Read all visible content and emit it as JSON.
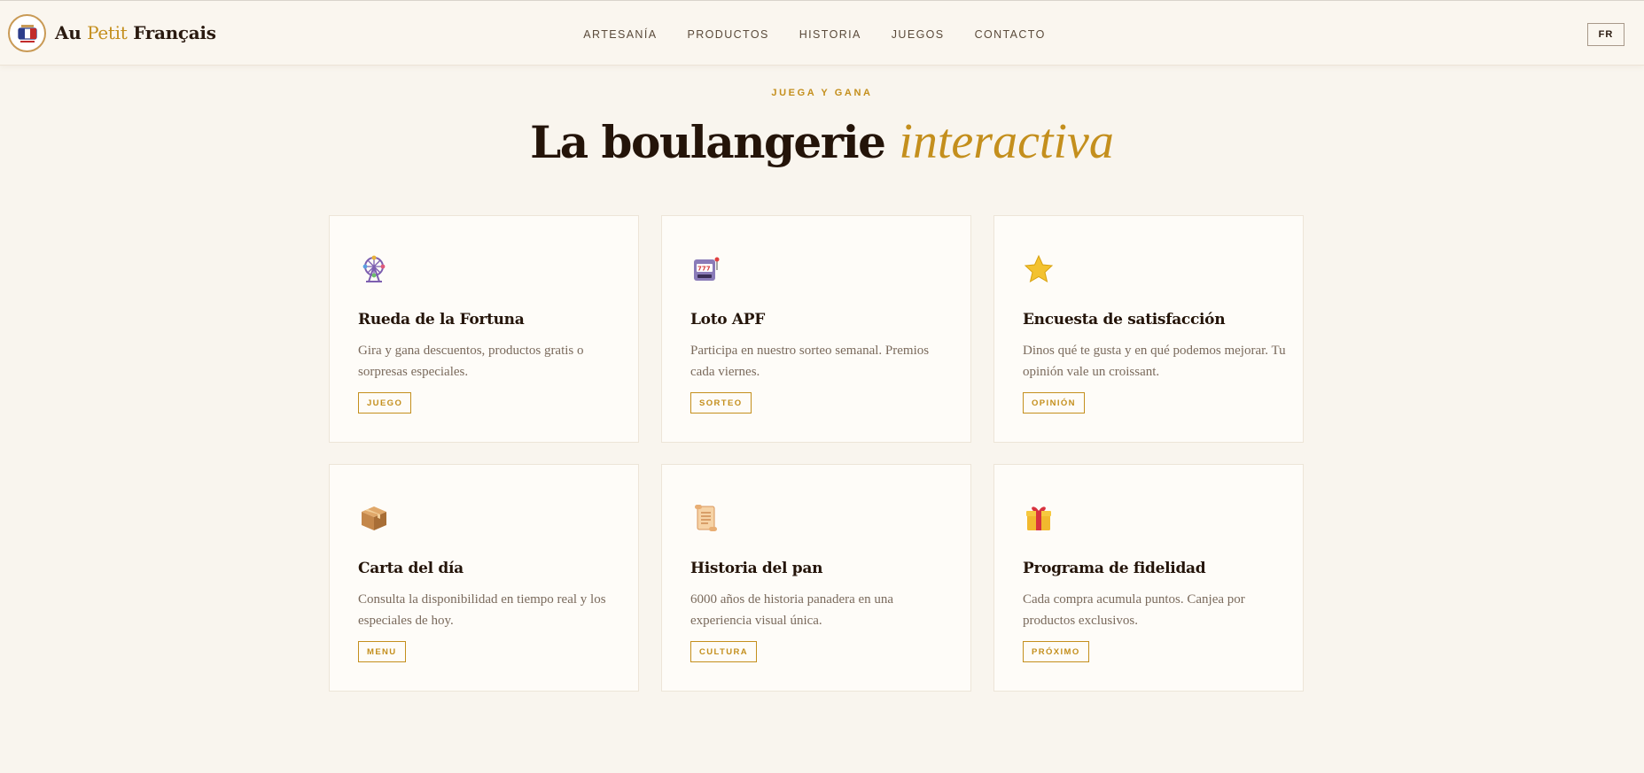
{
  "header": {
    "brand": {
      "part1": "Au",
      "part2": "Petit",
      "part3": "Français"
    },
    "nav": [
      "ARTESANÍA",
      "PRODUCTOS",
      "HISTORIA",
      "JUEGOS",
      "CONTACTO"
    ],
    "lang": "FR"
  },
  "hero": {
    "eyebrow": "JUEGA Y GANA",
    "title_main": "La boulangerie",
    "title_accent": "interactiva"
  },
  "cards": [
    {
      "icon": "ferris-wheel-icon",
      "title": "Rueda de la Fortuna",
      "desc": "Gira y gana descuentos, productos gratis o sorpresas especiales.",
      "tag": "JUEGO"
    },
    {
      "icon": "slot-machine-icon",
      "title": "Loto APF",
      "desc": "Participa en nuestro sorteo semanal. Premios cada viernes.",
      "tag": "SORTEO"
    },
    {
      "icon": "star-icon",
      "title": "Encuesta de satisfacción",
      "desc": "Dinos qué te gusta y en qué podemos mejorar. Tu opinión vale un croissant.",
      "tag": "OPINIÓN"
    },
    {
      "icon": "box-icon",
      "title": "Carta del día",
      "desc": "Consulta la disponibilidad en tiempo real y los especiales de hoy.",
      "tag": "MENU"
    },
    {
      "icon": "scroll-icon",
      "title": "Historia del pan",
      "desc": "6000 años de historia panadera en una experiencia visual única.",
      "tag": "CULTURA"
    },
    {
      "icon": "gift-icon",
      "title": "Programa de fidelidad",
      "desc": "Cada compra acumula puntos. Canjea por productos exclusivos.",
      "tag": "PRÓXIMO"
    }
  ],
  "colors": {
    "accent": "#c48f1d",
    "background": "#f9f5ee",
    "card": "#fefcf8",
    "text": "#241409"
  }
}
